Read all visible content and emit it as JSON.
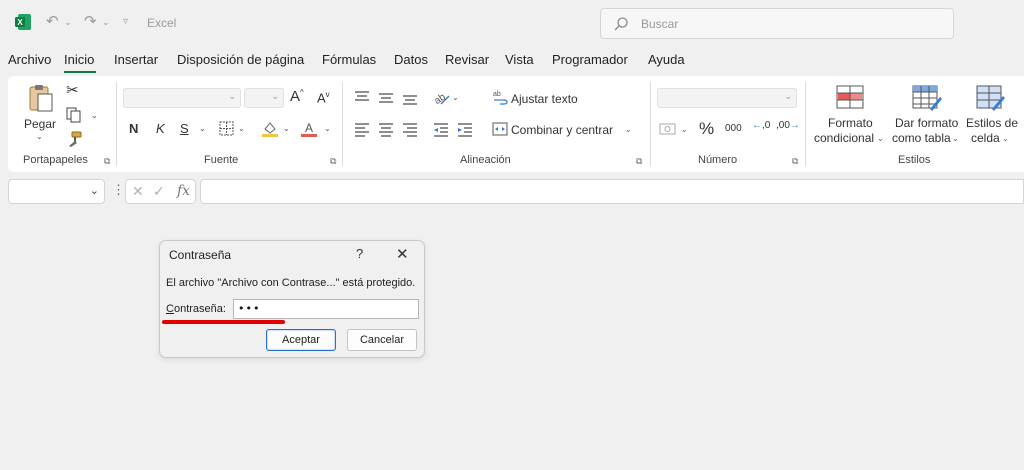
{
  "titlebar": {
    "app_title": "Excel",
    "search_placeholder": "Buscar",
    "icons": [
      "excel-logo-icon",
      "undo-icon",
      "redo-icon",
      "customize-qat-icon",
      "search-icon"
    ]
  },
  "menu": {
    "tabs": [
      "Archivo",
      "Inicio",
      "Insertar",
      "Disposición de página",
      "Fórmulas",
      "Datos",
      "Revisar",
      "Vista",
      "Programador",
      "Ayuda"
    ],
    "active_tab": "Inicio"
  },
  "ribbon": {
    "clipboard": {
      "paste_label": "Pegar",
      "group_label": "Portapapeles"
    },
    "font": {
      "bold": "N",
      "italic": "K",
      "underline": "S",
      "grow": "A",
      "shrink": "A",
      "group_label": "Fuente"
    },
    "alignment": {
      "wrap_text": "Ajustar texto",
      "merge_center": "Combinar y centrar",
      "group_label": "Alineación"
    },
    "number": {
      "percent": "%",
      "thousands": "000",
      "inc_decimal": ",0",
      "dec_decimal": ",00",
      "group_label": "Número"
    },
    "styles": {
      "conditional_line1": "Formato",
      "conditional_line2": "condicional",
      "table_line1": "Dar formato",
      "table_line2": "como tabla",
      "cell_line1": "Estilos de",
      "cell_line2": "celda",
      "group_label": "Estilos"
    }
  },
  "formula_bar": {
    "cancel": "✕",
    "enter": "✓",
    "fx": "fx"
  },
  "dialog": {
    "title": "Contraseña",
    "help": "?",
    "close": "✕",
    "message": "El archivo \"Archivo con Contrase...\" está protegido.",
    "label_accel": "C",
    "label_rest": "ontraseña:",
    "password_value": "•••",
    "ok_label": "Aceptar",
    "cancel_label": "Cancelar"
  },
  "colors": {
    "accent": "#107c41",
    "annotation": "#e00000",
    "primary_button_border": "#2a6fd0"
  }
}
